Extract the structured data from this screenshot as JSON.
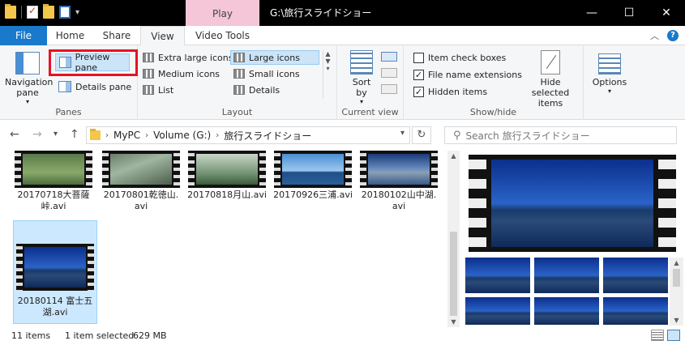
{
  "window": {
    "title": "G:\\旅行スライドショー",
    "context_tab": "Play",
    "buttons": {
      "minimize": "—",
      "maximize": "☐",
      "close": "✕"
    }
  },
  "tabs": {
    "file": "File",
    "home": "Home",
    "share": "Share",
    "view": "View",
    "video_tools": "Video Tools"
  },
  "ribbon": {
    "panes": {
      "navigation_pane": "Navigation pane",
      "preview_pane": "Preview pane",
      "details_pane": "Details pane",
      "label": "Panes"
    },
    "layout": {
      "items": [
        "Extra large icons",
        "Large icons",
        "Medium icons",
        "Small icons",
        "List",
        "Details"
      ],
      "selected": "Large icons",
      "label": "Layout"
    },
    "current_view": {
      "sort_by": "Sort by",
      "label": "Current view"
    },
    "show_hide": {
      "item_check_boxes": "Item check boxes",
      "file_name_extensions": "File name extensions",
      "hidden_items": "Hidden items",
      "hide_selected_items": "Hide selected items",
      "label": "Show/hide",
      "checked": {
        "item_check_boxes": false,
        "file_name_extensions": true,
        "hidden_items": true
      }
    },
    "options": "Options"
  },
  "address": {
    "crumbs": [
      "MyPC",
      "Volume (G:)",
      "旅行スライドショー"
    ],
    "search_placeholder": "Search 旅行スライドショー"
  },
  "files": [
    {
      "name": "20170718大菩薩峠.avi",
      "line1": "20170718大菩薩",
      "line2": "峠.avi",
      "frame": "f-green"
    },
    {
      "name": "20170801乾徳山.avi",
      "line1": "20170801乾徳山.",
      "line2": "avi",
      "frame": "f-cliff"
    },
    {
      "name": "20170818月山.avi",
      "line1": "20170818月山.avi",
      "line2": "",
      "frame": "f-mist"
    },
    {
      "name": "20170926三浦.avi",
      "line1": "20170926三浦.avi",
      "line2": "",
      "frame": "f-sea"
    },
    {
      "name": "20180102山中湖.avi",
      "line1": "20180102山中湖.",
      "line2": "avi",
      "frame": "f-lake"
    },
    {
      "name": "20180114 富士五湖.avi",
      "line1": "20180114 富士五",
      "line2": "湖.avi",
      "frame": "f-fuji",
      "selected": true
    }
  ],
  "status": {
    "items": "11 items",
    "selected": "1 item selected",
    "size": "629 MB"
  },
  "colors": {
    "accent": "#1979ca",
    "highlight_red": "#e81123",
    "selection": "#cce8ff",
    "play_tab": "#f4c6d8"
  }
}
